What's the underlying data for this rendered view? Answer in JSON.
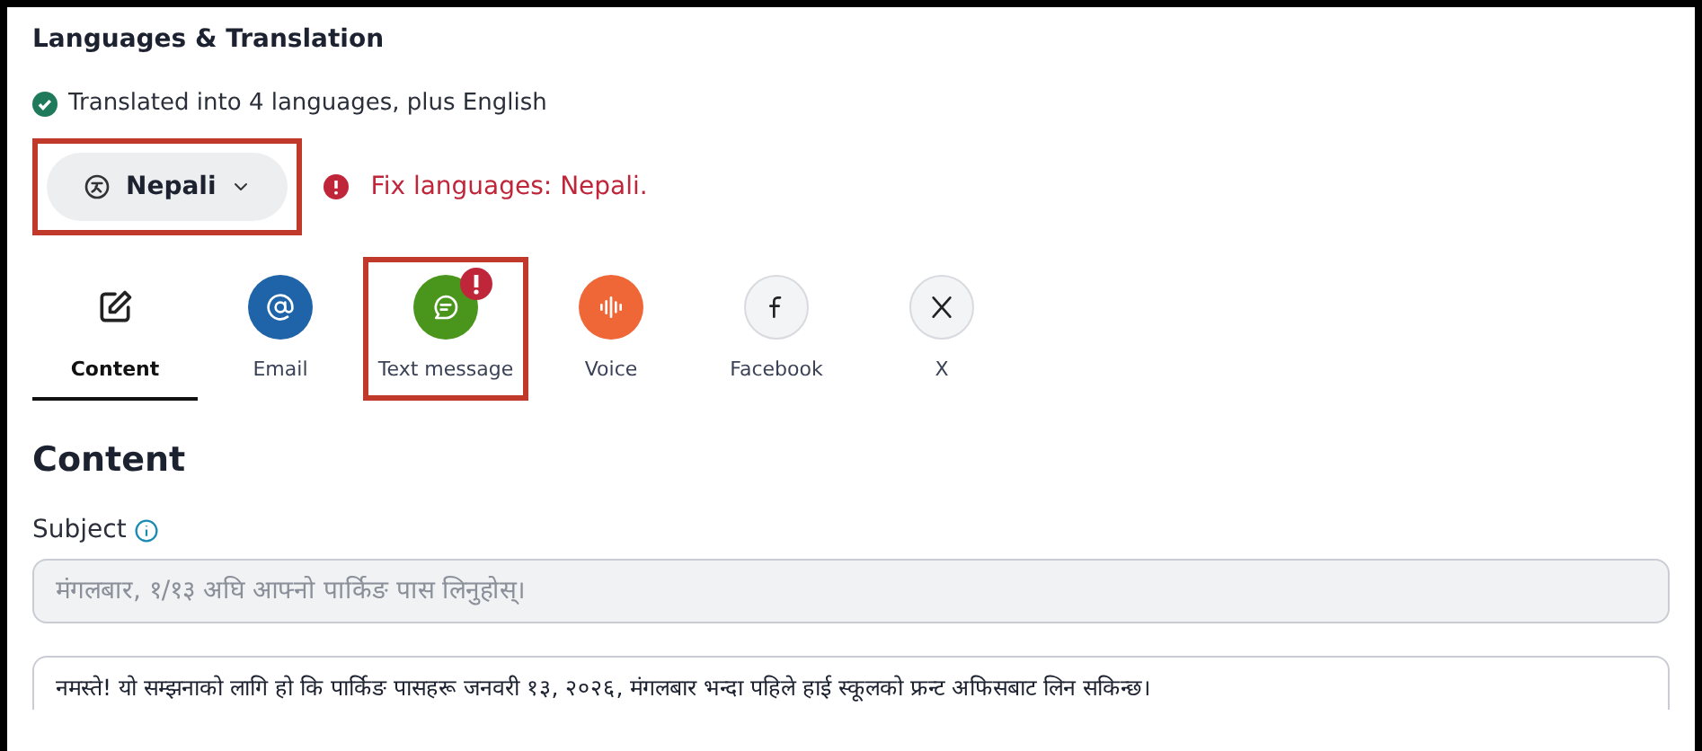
{
  "section_title": "Languages & Translation",
  "translation_status": {
    "text": "Translated into 4 languages, plus English",
    "ok": true
  },
  "language_select": {
    "value": "Nepali",
    "highlighted": true
  },
  "error": {
    "text": "Fix languages: Nepali."
  },
  "tabs": [
    {
      "label": "Content",
      "kind": "content",
      "selected": true,
      "alert": false,
      "highlighted": false
    },
    {
      "label": "Email",
      "kind": "email",
      "selected": false,
      "alert": false,
      "highlighted": false
    },
    {
      "label": "Text message",
      "kind": "sms",
      "selected": false,
      "alert": true,
      "highlighted": true
    },
    {
      "label": "Voice",
      "kind": "voice",
      "selected": false,
      "alert": false,
      "highlighted": false
    },
    {
      "label": "Facebook",
      "kind": "facebook",
      "selected": false,
      "alert": false,
      "highlighted": false
    },
    {
      "label": "X",
      "kind": "x",
      "selected": false,
      "alert": false,
      "highlighted": false
    }
  ],
  "content": {
    "heading": "Content",
    "subject_label": "Subject",
    "subject_placeholder": "मंगलबार, १/१३ अघि आफ्नो पार्किङ पास लिनुहोस्।",
    "body": "नमस्ते! यो सम्झनाको लागि हो कि पार्किङ पासहरू जनवरी १३, २०२६, मंगलबार भन्दा पहिले हाई स्कूलको फ्रन्ट अफिसबाट लिन सकिन्छ।"
  }
}
